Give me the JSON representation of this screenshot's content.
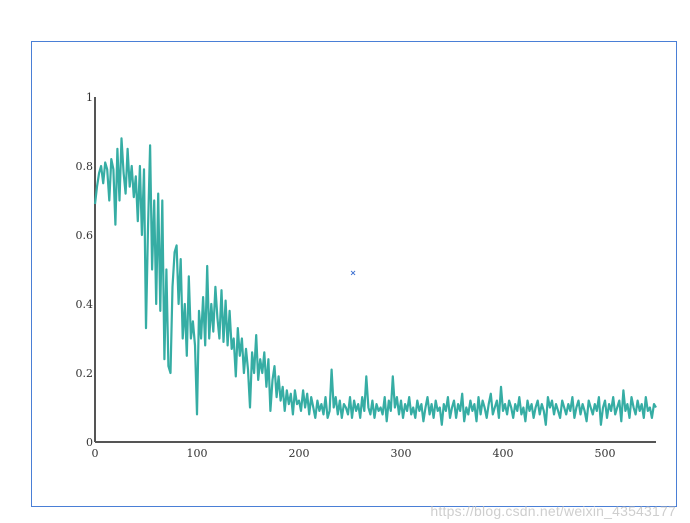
{
  "chart_data": {
    "type": "line",
    "title": "",
    "xlabel": "",
    "ylabel": "",
    "xlim": [
      0,
      550
    ],
    "ylim": [
      0,
      1
    ],
    "x_ticks": [
      "0",
      "100",
      "200",
      "300",
      "400",
      "500"
    ],
    "y_ticks": [
      "0",
      "0.2",
      "0.4",
      "0.6",
      "0.8",
      "1"
    ],
    "grid": false,
    "series": [
      {
        "color": "#36ada4",
        "points": [
          [
            0,
            0.69
          ],
          [
            2,
            0.74
          ],
          [
            4,
            0.78
          ],
          [
            6,
            0.8
          ],
          [
            8,
            0.75
          ],
          [
            10,
            0.81
          ],
          [
            12,
            0.79
          ],
          [
            14,
            0.7
          ],
          [
            16,
            0.82
          ],
          [
            18,
            0.79
          ],
          [
            20,
            0.63
          ],
          [
            22,
            0.85
          ],
          [
            24,
            0.7
          ],
          [
            26,
            0.88
          ],
          [
            28,
            0.78
          ],
          [
            30,
            0.72
          ],
          [
            32,
            0.85
          ],
          [
            34,
            0.74
          ],
          [
            36,
            0.8
          ],
          [
            38,
            0.71
          ],
          [
            40,
            0.77
          ],
          [
            42,
            0.64
          ],
          [
            44,
            0.8
          ],
          [
            46,
            0.6
          ],
          [
            48,
            0.79
          ],
          [
            50,
            0.33
          ],
          [
            52,
            0.62
          ],
          [
            54,
            0.86
          ],
          [
            56,
            0.5
          ],
          [
            58,
            0.7
          ],
          [
            60,
            0.4
          ],
          [
            62,
            0.72
          ],
          [
            64,
            0.38
          ],
          [
            66,
            0.7
          ],
          [
            68,
            0.24
          ],
          [
            70,
            0.5
          ],
          [
            72,
            0.22
          ],
          [
            74,
            0.2
          ],
          [
            76,
            0.45
          ],
          [
            78,
            0.55
          ],
          [
            80,
            0.57
          ],
          [
            82,
            0.4
          ],
          [
            84,
            0.53
          ],
          [
            86,
            0.3
          ],
          [
            88,
            0.4
          ],
          [
            90,
            0.25
          ],
          [
            92,
            0.48
          ],
          [
            94,
            0.3
          ],
          [
            96,
            0.35
          ],
          [
            98,
            0.28
          ],
          [
            100,
            0.08
          ],
          [
            102,
            0.38
          ],
          [
            104,
            0.3
          ],
          [
            106,
            0.42
          ],
          [
            108,
            0.28
          ],
          [
            110,
            0.51
          ],
          [
            112,
            0.3
          ],
          [
            114,
            0.4
          ],
          [
            116,
            0.32
          ],
          [
            118,
            0.45
          ],
          [
            120,
            0.36
          ],
          [
            122,
            0.3
          ],
          [
            124,
            0.44
          ],
          [
            126,
            0.29
          ],
          [
            128,
            0.41
          ],
          [
            130,
            0.28
          ],
          [
            132,
            0.38
          ],
          [
            134,
            0.27
          ],
          [
            136,
            0.3
          ],
          [
            138,
            0.19
          ],
          [
            140,
            0.33
          ],
          [
            142,
            0.25
          ],
          [
            144,
            0.3
          ],
          [
            146,
            0.2
          ],
          [
            148,
            0.27
          ],
          [
            150,
            0.21
          ],
          [
            152,
            0.1
          ],
          [
            154,
            0.26
          ],
          [
            156,
            0.2
          ],
          [
            158,
            0.31
          ],
          [
            160,
            0.18
          ],
          [
            162,
            0.24
          ],
          [
            164,
            0.2
          ],
          [
            166,
            0.26
          ],
          [
            168,
            0.16
          ],
          [
            170,
            0.24
          ],
          [
            172,
            0.09
          ],
          [
            174,
            0.18
          ],
          [
            176,
            0.22
          ],
          [
            178,
            0.13
          ],
          [
            180,
            0.19
          ],
          [
            182,
            0.12
          ],
          [
            184,
            0.16
          ],
          [
            186,
            0.09
          ],
          [
            188,
            0.15
          ],
          [
            190,
            0.11
          ],
          [
            192,
            0.14
          ],
          [
            194,
            0.08
          ],
          [
            196,
            0.15
          ],
          [
            198,
            0.11
          ],
          [
            200,
            0.12
          ],
          [
            202,
            0.09
          ],
          [
            204,
            0.15
          ],
          [
            206,
            0.1
          ],
          [
            208,
            0.14
          ],
          [
            210,
            0.08
          ],
          [
            212,
            0.13
          ],
          [
            214,
            0.1
          ],
          [
            216,
            0.07
          ],
          [
            218,
            0.12
          ],
          [
            220,
            0.09
          ],
          [
            222,
            0.11
          ],
          [
            224,
            0.08
          ],
          [
            226,
            0.13
          ],
          [
            228,
            0.07
          ],
          [
            230,
            0.09
          ],
          [
            232,
            0.21
          ],
          [
            234,
            0.1
          ],
          [
            236,
            0.13
          ],
          [
            238,
            0.08
          ],
          [
            240,
            0.12
          ],
          [
            242,
            0.07
          ],
          [
            244,
            0.11
          ],
          [
            246,
            0.1
          ],
          [
            248,
            0.08
          ],
          [
            250,
            0.13
          ],
          [
            252,
            0.07
          ],
          [
            254,
            0.12
          ],
          [
            256,
            0.09
          ],
          [
            258,
            0.11
          ],
          [
            260,
            0.07
          ],
          [
            262,
            0.13
          ],
          [
            264,
            0.09
          ],
          [
            266,
            0.19
          ],
          [
            268,
            0.1
          ],
          [
            270,
            0.08
          ],
          [
            272,
            0.12
          ],
          [
            274,
            0.07
          ],
          [
            276,
            0.11
          ],
          [
            278,
            0.09
          ],
          [
            280,
            0.1
          ],
          [
            282,
            0.08
          ],
          [
            284,
            0.13
          ],
          [
            286,
            0.06
          ],
          [
            288,
            0.12
          ],
          [
            290,
            0.09
          ],
          [
            292,
            0.19
          ],
          [
            294,
            0.1
          ],
          [
            296,
            0.13
          ],
          [
            298,
            0.08
          ],
          [
            300,
            0.12
          ],
          [
            302,
            0.07
          ],
          [
            304,
            0.11
          ],
          [
            306,
            0.09
          ],
          [
            308,
            0.13
          ],
          [
            310,
            0.08
          ],
          [
            312,
            0.1
          ],
          [
            314,
            0.07
          ],
          [
            316,
            0.12
          ],
          [
            318,
            0.09
          ],
          [
            320,
            0.11
          ],
          [
            322,
            0.06
          ],
          [
            324,
            0.1
          ],
          [
            326,
            0.13
          ],
          [
            328,
            0.08
          ],
          [
            330,
            0.11
          ],
          [
            332,
            0.07
          ],
          [
            334,
            0.12
          ],
          [
            336,
            0.09
          ],
          [
            338,
            0.1
          ],
          [
            340,
            0.05
          ],
          [
            342,
            0.11
          ],
          [
            344,
            0.09
          ],
          [
            346,
            0.13
          ],
          [
            348,
            0.07
          ],
          [
            350,
            0.1
          ],
          [
            352,
            0.12
          ],
          [
            354,
            0.07
          ],
          [
            356,
            0.11
          ],
          [
            358,
            0.09
          ],
          [
            360,
            0.14
          ],
          [
            362,
            0.06
          ],
          [
            364,
            0.1
          ],
          [
            366,
            0.08
          ],
          [
            368,
            0.12
          ],
          [
            370,
            0.09
          ],
          [
            372,
            0.11
          ],
          [
            374,
            0.06
          ],
          [
            376,
            0.13
          ],
          [
            378,
            0.08
          ],
          [
            380,
            0.12
          ],
          [
            382,
            0.1
          ],
          [
            384,
            0.07
          ],
          [
            386,
            0.11
          ],
          [
            388,
            0.14
          ],
          [
            390,
            0.08
          ],
          [
            392,
            0.1
          ],
          [
            394,
            0.12
          ],
          [
            396,
            0.07
          ],
          [
            398,
            0.16
          ],
          [
            400,
            0.09
          ],
          [
            402,
            0.11
          ],
          [
            404,
            0.08
          ],
          [
            406,
            0.12
          ],
          [
            408,
            0.1
          ],
          [
            410,
            0.07
          ],
          [
            412,
            0.11
          ],
          [
            414,
            0.09
          ],
          [
            416,
            0.13
          ],
          [
            418,
            0.08
          ],
          [
            420,
            0.1
          ],
          [
            422,
            0.06
          ],
          [
            424,
            0.12
          ],
          [
            426,
            0.09
          ],
          [
            428,
            0.11
          ],
          [
            430,
            0.07
          ],
          [
            432,
            0.1
          ],
          [
            434,
            0.12
          ],
          [
            436,
            0.08
          ],
          [
            438,
            0.11
          ],
          [
            440,
            0.09
          ],
          [
            442,
            0.05
          ],
          [
            444,
            0.13
          ],
          [
            446,
            0.1
          ],
          [
            448,
            0.12
          ],
          [
            450,
            0.08
          ],
          [
            452,
            0.11
          ],
          [
            454,
            0.09
          ],
          [
            456,
            0.07
          ],
          [
            458,
            0.12
          ],
          [
            460,
            0.1
          ],
          [
            462,
            0.08
          ],
          [
            464,
            0.11
          ],
          [
            466,
            0.09
          ],
          [
            468,
            0.13
          ],
          [
            470,
            0.07
          ],
          [
            472,
            0.1
          ],
          [
            474,
            0.12
          ],
          [
            476,
            0.08
          ],
          [
            478,
            0.11
          ],
          [
            480,
            0.09
          ],
          [
            482,
            0.06
          ],
          [
            484,
            0.12
          ],
          [
            486,
            0.1
          ],
          [
            488,
            0.08
          ],
          [
            490,
            0.11
          ],
          [
            492,
            0.09
          ],
          [
            494,
            0.13
          ],
          [
            496,
            0.05
          ],
          [
            498,
            0.1
          ],
          [
            500,
            0.12
          ],
          [
            502,
            0.07
          ],
          [
            504,
            0.11
          ],
          [
            506,
            0.09
          ],
          [
            508,
            0.13
          ],
          [
            510,
            0.08
          ],
          [
            512,
            0.1
          ],
          [
            514,
            0.12
          ],
          [
            516,
            0.06
          ],
          [
            518,
            0.15
          ],
          [
            520,
            0.09
          ],
          [
            522,
            0.11
          ],
          [
            524,
            0.07
          ],
          [
            526,
            0.13
          ],
          [
            528,
            0.1
          ],
          [
            530,
            0.08
          ],
          [
            532,
            0.12
          ],
          [
            534,
            0.09
          ],
          [
            536,
            0.11
          ],
          [
            538,
            0.07
          ],
          [
            540,
            0.13
          ],
          [
            542,
            0.09
          ],
          [
            544,
            0.1
          ],
          [
            546,
            0.07
          ],
          [
            548,
            0.11
          ],
          [
            550,
            0.1
          ]
        ]
      }
    ],
    "annotations": [
      {
        "type": "marker",
        "symbol": "x",
        "x": 253,
        "y": 0.49,
        "color": "#3b6fd0"
      }
    ]
  },
  "watermark": "https://blog.csdn.net/weixin_43543177"
}
